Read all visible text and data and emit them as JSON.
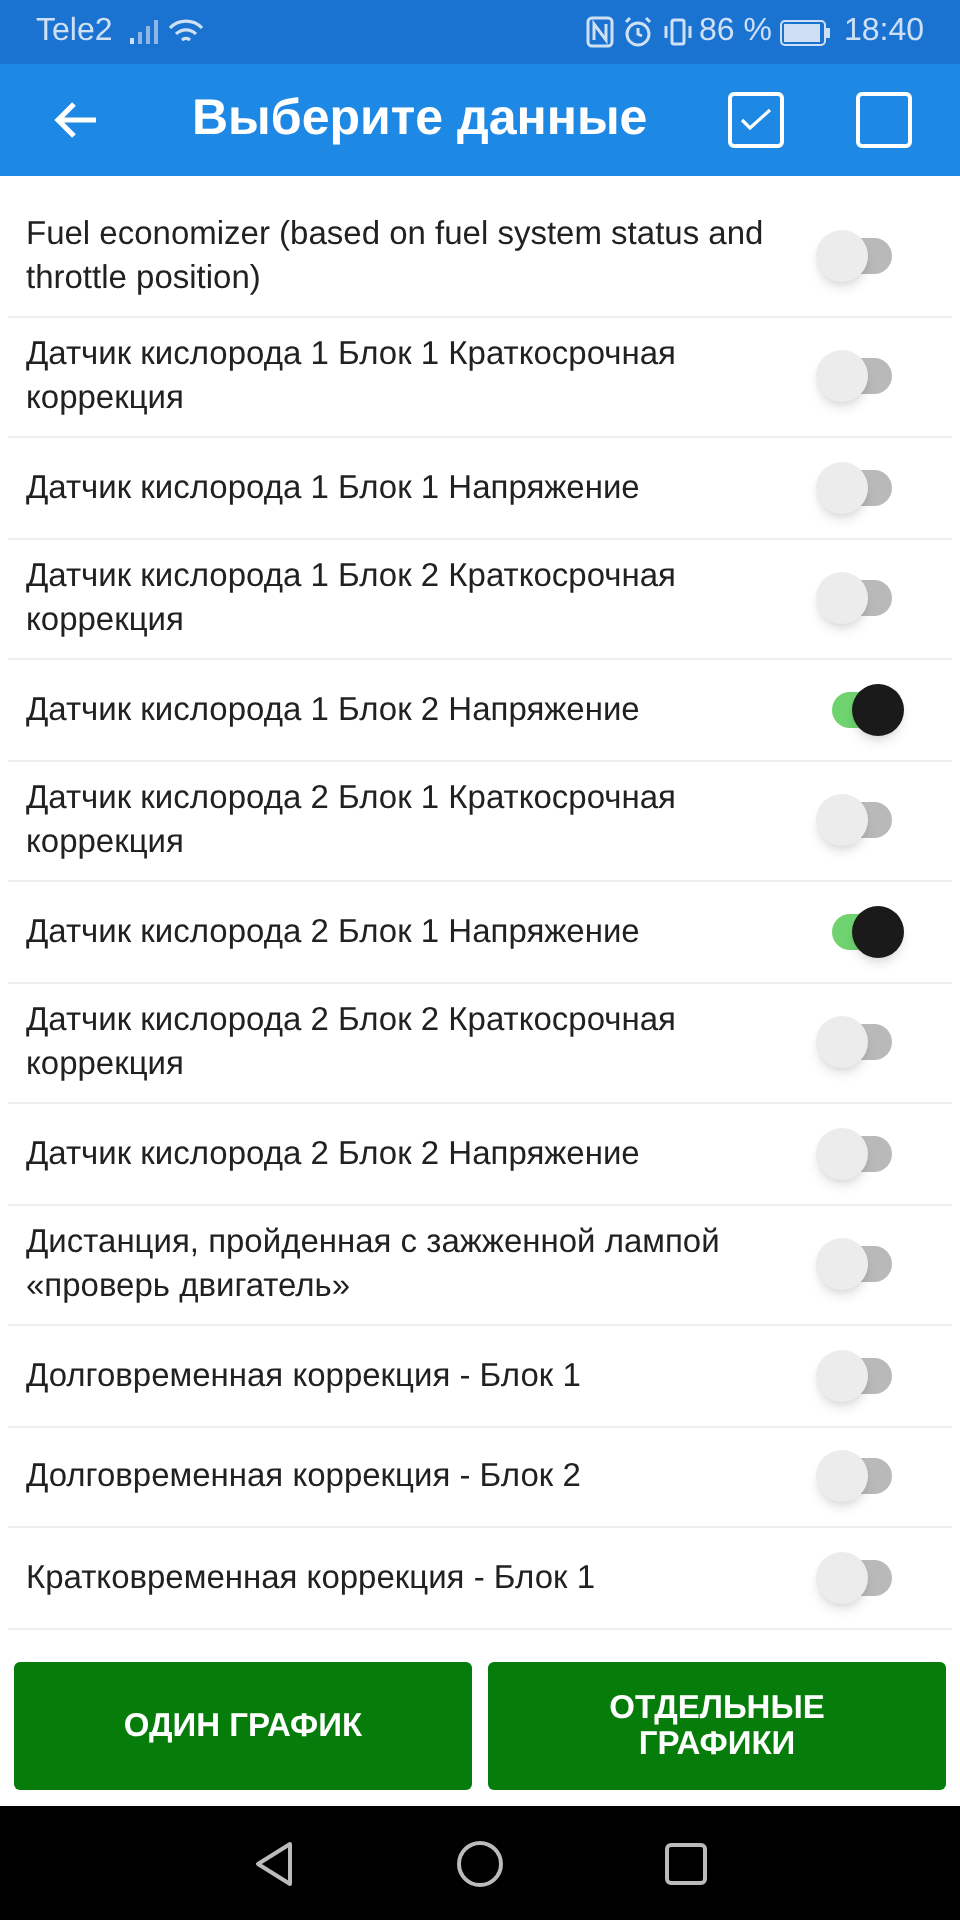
{
  "status_bar": {
    "carrier": "Tele2",
    "battery": "86 %",
    "time": "18:40"
  },
  "header": {
    "title": "Выберите данные"
  },
  "items": [
    {
      "label": "Fuel economizer (based on fuel system status and throttle position)",
      "on": false
    },
    {
      "label": "Датчик кислорода 1 Блок 1 Краткосрочная коррекция",
      "on": false
    },
    {
      "label": "Датчик кислорода 1 Блок 1 Напряжение",
      "on": false
    },
    {
      "label": "Датчик кислорода 1 Блок 2 Краткосрочная коррекция",
      "on": false
    },
    {
      "label": "Датчик кислорода 1 Блок 2 Напряжение",
      "on": true
    },
    {
      "label": "Датчик кислорода 2 Блок 1 Краткосрочная коррекция",
      "on": false
    },
    {
      "label": "Датчик кислорода 2 Блок 1 Напряжение",
      "on": true
    },
    {
      "label": "Датчик кислорода 2 Блок 2 Краткосрочная коррекция",
      "on": false
    },
    {
      "label": "Датчик кислорода 2 Блок 2 Напряжение",
      "on": false
    },
    {
      "label": "Дистанция, пройденная с зажженной лампой «проверь двигатель»",
      "on": false
    },
    {
      "label": "Долговременная коррекция - Блок 1",
      "on": false
    },
    {
      "label": "Долговременная коррекция - Блок 2",
      "on": false
    },
    {
      "label": "Кратковременная коррекция - Блок 1",
      "on": false
    }
  ],
  "buttons": [
    "ОДИН ГРАФИК",
    "ОТДЕЛЬНЫЕ ГРАФИКИ"
  ]
}
